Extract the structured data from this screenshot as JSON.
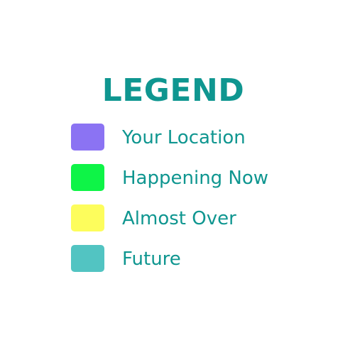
{
  "legend": {
    "title": "LEGEND",
    "text_color": "#0f9690",
    "items": [
      {
        "label": "Your Location",
        "color": "#8b73f3"
      },
      {
        "label": "Happening Now",
        "color": "#0ef447"
      },
      {
        "label": "Almost Over",
        "color": "#fdfd5c"
      },
      {
        "label": "Future",
        "color": "#52c4c2"
      }
    ]
  }
}
